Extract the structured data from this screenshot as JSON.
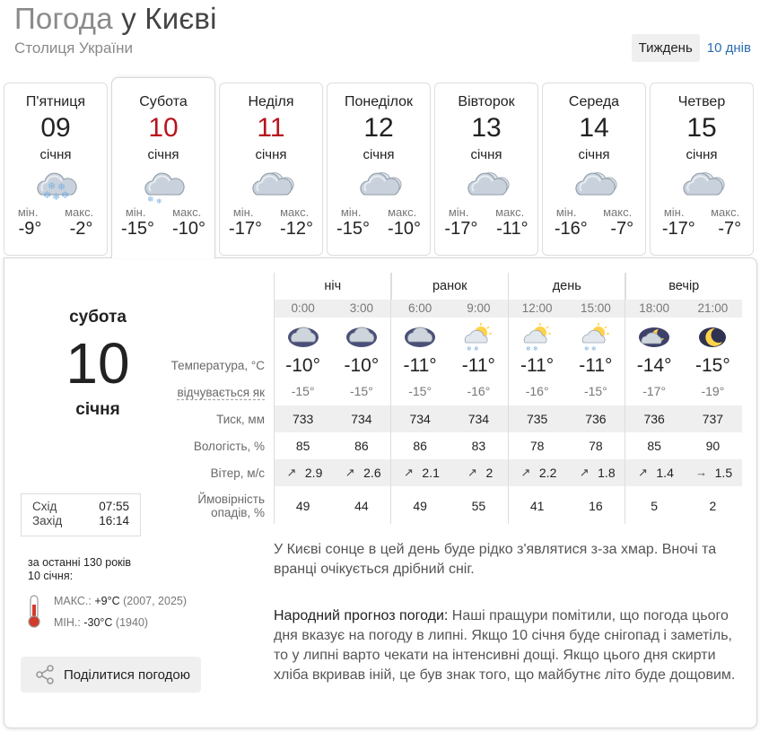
{
  "header": {
    "title_prefix": "Погода",
    "title_city": "у Києві",
    "subtitle": "Столиця України",
    "tab_week": "Тиждень",
    "tab_10days": "10 днів"
  },
  "days": [
    {
      "name": "П'ятниця",
      "num": "09",
      "month": "січня",
      "min_label": "мін.",
      "max_label": "макс.",
      "min": "-9°",
      "max": "-2°",
      "icon": "snow-cloud-icon"
    },
    {
      "name": "Субота",
      "num": "10",
      "month": "січня",
      "min_label": "мін.",
      "max_label": "макс.",
      "min": "-15°",
      "max": "-10°",
      "icon": "light-snow-icon"
    },
    {
      "name": "Неділя",
      "num": "11",
      "month": "січня",
      "min_label": "мін.",
      "max_label": "макс.",
      "min": "-17°",
      "max": "-12°",
      "icon": "cloudy-icon"
    },
    {
      "name": "Понеділок",
      "num": "12",
      "month": "січня",
      "min_label": "мін.",
      "max_label": "макс.",
      "min": "-15°",
      "max": "-10°",
      "icon": "cloudy-icon"
    },
    {
      "name": "Вівторок",
      "num": "13",
      "month": "січня",
      "min_label": "мін.",
      "max_label": "макс.",
      "min": "-17°",
      "max": "-11°",
      "icon": "cloudy-icon"
    },
    {
      "name": "Середа",
      "num": "14",
      "month": "січня",
      "min_label": "мін.",
      "max_label": "макс.",
      "min": "-16°",
      "max": "-7°",
      "icon": "cloudy-icon"
    },
    {
      "name": "Четвер",
      "num": "15",
      "month": "січня",
      "min_label": "мін.",
      "max_label": "макс.",
      "min": "-17°",
      "max": "-7°",
      "icon": "cloudy-icon"
    }
  ],
  "selected": {
    "day_name": "субота",
    "num": "10",
    "month": "січня",
    "sunrise_label": "Схід",
    "sunrise": "07:55",
    "sunset_label": "Захід",
    "sunset": "16:14",
    "history_line1": "за останні 130 років",
    "history_line2": "10 січня:",
    "max_label": "МАКС.:",
    "max_value": "+9°C",
    "max_years": "(2007, 2025)",
    "min_label": "МІН.:",
    "min_value": "-30°C",
    "min_years": "(1940)",
    "share_label": "Поділитися погодою"
  },
  "hourly": {
    "parts": [
      "ніч",
      "ранок",
      "день",
      "вечір"
    ],
    "hours": [
      "0:00",
      "3:00",
      "6:00",
      "9:00",
      "12:00",
      "15:00",
      "18:00",
      "21:00"
    ],
    "icons": [
      "night-cloud-icon",
      "night-cloud-icon",
      "night-cloud-icon",
      "sun-cloud-snow-icon",
      "sun-cloud-snow-icon",
      "sun-cloud-snow-icon",
      "moon-cloud-icon",
      "moon-icon"
    ],
    "labels": {
      "temp": "Температура, °C",
      "feels": "відчувається як",
      "pressure": "Тиск, мм",
      "humidity": "Вологість, %",
      "wind": "Вітер, м/с",
      "precip1": "Ймовірність",
      "precip2": "опадів, %"
    },
    "temp": [
      "-10°",
      "-10°",
      "-11°",
      "-11°",
      "-11°",
      "-11°",
      "-14°",
      "-15°"
    ],
    "feels": [
      "-15°",
      "-15°",
      "-15°",
      "-16°",
      "-16°",
      "-15°",
      "-17°",
      "-19°"
    ],
    "pressure": [
      "733",
      "734",
      "734",
      "734",
      "735",
      "736",
      "736",
      "737"
    ],
    "humidity": [
      "85",
      "86",
      "86",
      "83",
      "78",
      "78",
      "85",
      "90"
    ],
    "wind": [
      "2.9",
      "2.6",
      "2.1",
      "2",
      "2.2",
      "1.8",
      "1.4",
      "1.5"
    ],
    "wind_dir": [
      "↗",
      "↗",
      "↗",
      "↗",
      "↗",
      "↗",
      "↗",
      "→"
    ],
    "precip": [
      "49",
      "44",
      "49",
      "55",
      "41",
      "16",
      "5",
      "2"
    ]
  },
  "description": "У Києві сонце в цей день буде рідко з'являтися з-за хмар. Вночі та вранці очікується дрібний сніг.",
  "folk": {
    "label": "Народний прогноз погоди:",
    "text": " Наші пращури помітили, що погода цього дня вказує на погоду в липні. Якщо 10 січня буде снігопад і заметіль, то у липні варто чекати на інтенсивні дощі. Якщо цього дня скирти хліба вкривав іній, це був знак того, що майбутнє літо буде дощовим."
  },
  "colors": {
    "link": "#2a6db0",
    "weekend": "#b8141e"
  }
}
